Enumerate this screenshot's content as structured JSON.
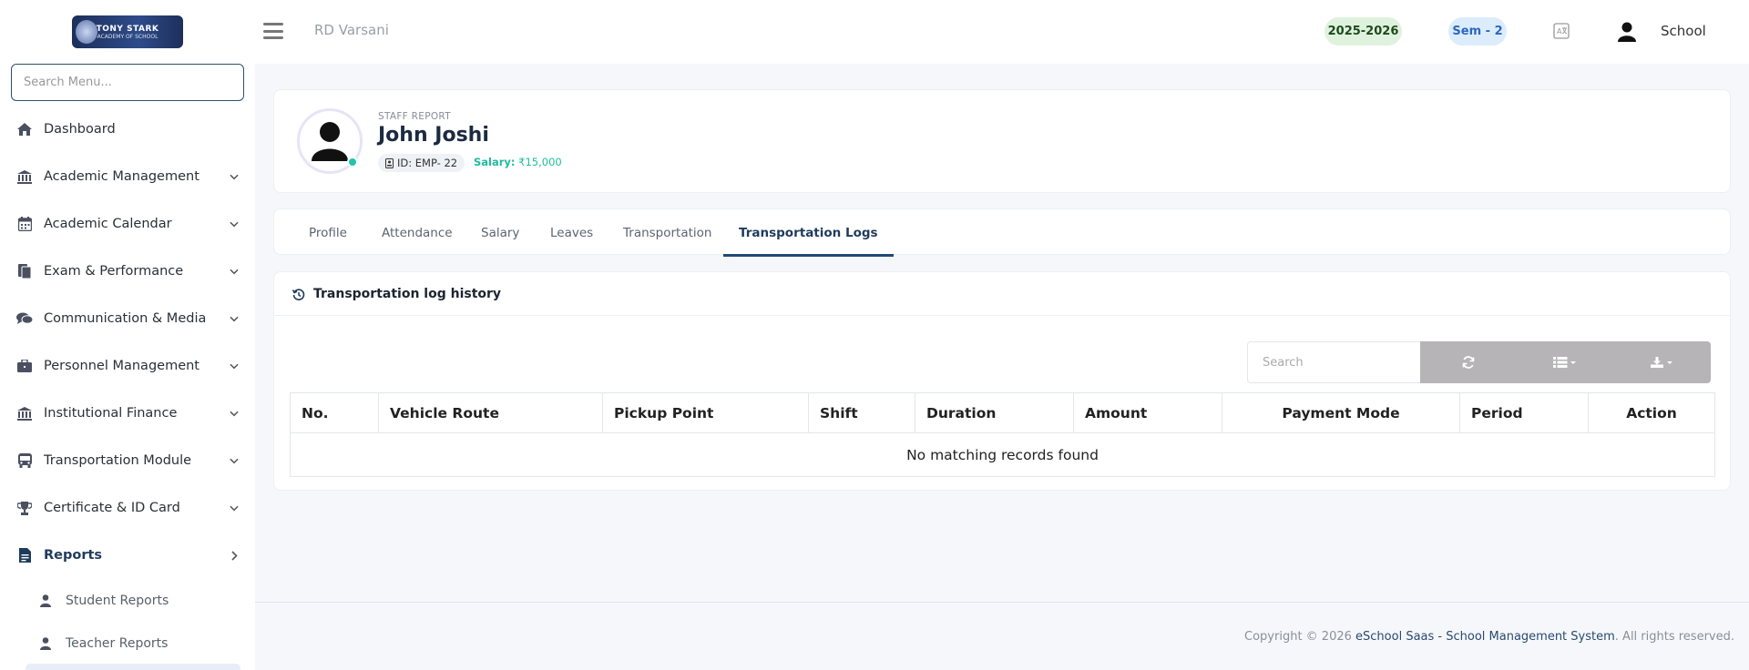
{
  "logo": {
    "line1": "TONY STARK",
    "line2": "ACADEMY OF SCHOOL"
  },
  "sidebar": {
    "search_placeholder": "Search Menu...",
    "items": [
      {
        "label": "Dashboard",
        "icon": "home-icon",
        "expandable": false
      },
      {
        "label": "Academic Management",
        "icon": "institution-icon",
        "expandable": true
      },
      {
        "label": "Academic Calendar",
        "icon": "calendar-icon",
        "expandable": true
      },
      {
        "label": "Exam & Performance",
        "icon": "exam-icon",
        "expandable": true
      },
      {
        "label": "Communication & Media",
        "icon": "chat-icon",
        "expandable": true
      },
      {
        "label": "Personnel Management",
        "icon": "briefcase-icon",
        "expandable": true
      },
      {
        "label": "Institutional Finance",
        "icon": "bank-icon",
        "expandable": true
      },
      {
        "label": "Transportation Module",
        "icon": "bus-icon",
        "expandable": true
      },
      {
        "label": "Certificate & ID Card",
        "icon": "trophy-icon",
        "expandable": true
      },
      {
        "label": "Reports",
        "icon": "report-icon",
        "expandable": true,
        "active": true
      }
    ],
    "sub_items": [
      {
        "label": "Student Reports",
        "icon": "user-icon"
      },
      {
        "label": "Teacher Reports",
        "icon": "user-icon"
      }
    ]
  },
  "topbar": {
    "school_name": "RD Varsani",
    "session": "2025-2026",
    "semester": "Sem - 2",
    "user_name": "School"
  },
  "profile": {
    "label": "STAFF REPORT",
    "name": "John Joshi",
    "id_text": "ID: EMP- 22",
    "salary_label": "Salary:",
    "salary_value": "₹15,000"
  },
  "tabs": [
    {
      "label": "Profile"
    },
    {
      "label": "Attendance"
    },
    {
      "label": "Salary"
    },
    {
      "label": "Leaves"
    },
    {
      "label": "Transportation"
    },
    {
      "label": "Transportation Logs",
      "active": true
    }
  ],
  "log": {
    "title": "Transportation log history",
    "search_placeholder": "Search",
    "columns": [
      "No.",
      "Vehicle Route",
      "Pickup Point",
      "Shift",
      "Duration",
      "Amount",
      "Payment Mode",
      "Period",
      "Action"
    ],
    "empty_message": "No matching records found"
  },
  "footer": {
    "prefix": "Copyright © 2026 ",
    "brand": "eSchool Saas - School Management System",
    "suffix": ". All rights reserved."
  },
  "colors": {
    "accent": "#1f4a78",
    "success": "#1ebd9f",
    "toolbar_gray": "#b6b4b6"
  }
}
